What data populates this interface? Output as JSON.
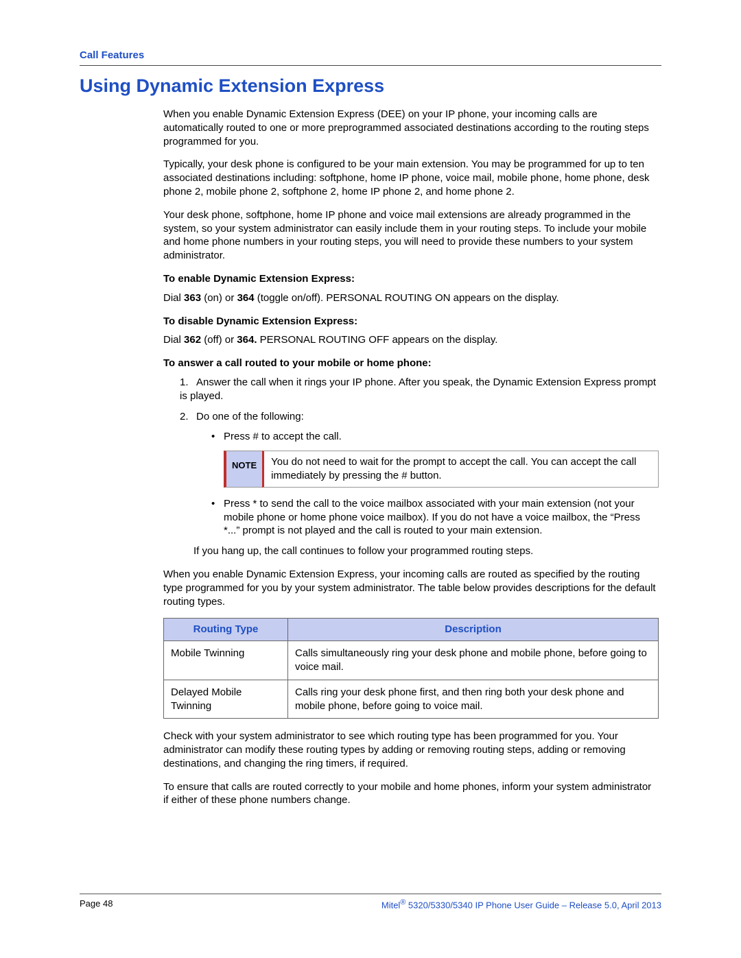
{
  "header": {
    "section": "Call Features",
    "title": "Using Dynamic Extension Express"
  },
  "paragraphs": {
    "intro1": "When you enable Dynamic Extension Express (DEE) on your IP phone, your incoming calls are automatically routed to one or more preprogrammed associated destinations according to the routing steps programmed for you.",
    "intro2": "Typically, your desk phone is configured to be your main extension. You may be programmed for up to ten associated destinations including: softphone, home IP phone, voice mail, mobile phone, home phone, desk phone 2, mobile phone 2, softphone 2, home IP phone 2, and home phone 2.",
    "intro3": "Your desk phone, softphone, home IP phone and voice mail extensions are already programmed in the system, so your system administrator can easily include them in your routing steps. To include your mobile and home phone numbers in your routing steps, you will need to provide these numbers to your system administrator.",
    "enable_heading": "To enable Dynamic Extension Express:",
    "enable_body_pre": "Dial ",
    "enable_body_b1": "363",
    "enable_body_mid": " (on) or ",
    "enable_body_b2": "364",
    "enable_body_post": " (toggle on/off). PERSONAL ROUTING ON appears on the display.",
    "disable_heading": "To disable Dynamic Extension Express:",
    "disable_body_pre": "Dial ",
    "disable_body_b1": "362",
    "disable_body_mid": " (off) or ",
    "disable_body_b2": "364.",
    "disable_body_post": " PERSONAL ROUTING OFF appears on the display.",
    "answer_heading": "To answer a call routed to your mobile or home phone:",
    "step1": "Answer the call when it rings your IP phone. After you speak, the Dynamic Extension Express prompt is played.",
    "step2": "Do one of the following:",
    "bullet_accept": "Press # to accept the call.",
    "note_label": "NOTE",
    "note_text": "You do not need to wait for the prompt to accept the call. You can accept the call immediately by pressing the # button.",
    "bullet_star": "Press * to send the call to the voice mailbox associated with your main extension (not your mobile phone or home phone voice mailbox). If you do not have a voice mailbox, the “Press *...” prompt is not played and the call is routed to your main extension.",
    "hangup": "If you hang up, the call continues to follow your programmed routing steps.",
    "routing_intro": "When you enable Dynamic Extension Express, your incoming calls are routed as specified by the routing type programmed for you by your system administrator. The table below provides descriptions for the default routing types.",
    "post_table1": "Check with your system administrator to see which routing type has been programmed for you. Your administrator can modify these routing types by adding or removing routing steps, adding or removing destinations, and changing the ring timers, if required.",
    "post_table2": "To ensure that calls are routed correctly to your mobile and home phones, inform your system administrator if either of these phone numbers change."
  },
  "table": {
    "headers": {
      "col1": "Routing Type",
      "col2": "Description"
    },
    "rows": [
      {
        "type": "Mobile Twinning",
        "desc": "Calls simultaneously ring your desk phone and mobile phone, before going to voice mail."
      },
      {
        "type": "Delayed Mobile Twinning",
        "desc": "Calls ring your desk phone first, and then ring both your desk phone and mobile phone, before going to voice mail."
      }
    ]
  },
  "footer": {
    "page": "Page 48",
    "doc_pre": "Mitel",
    "doc_sup": "®",
    "doc_post": " 5320/5330/5340 IP Phone User Guide – Release 5.0, April 2013"
  }
}
